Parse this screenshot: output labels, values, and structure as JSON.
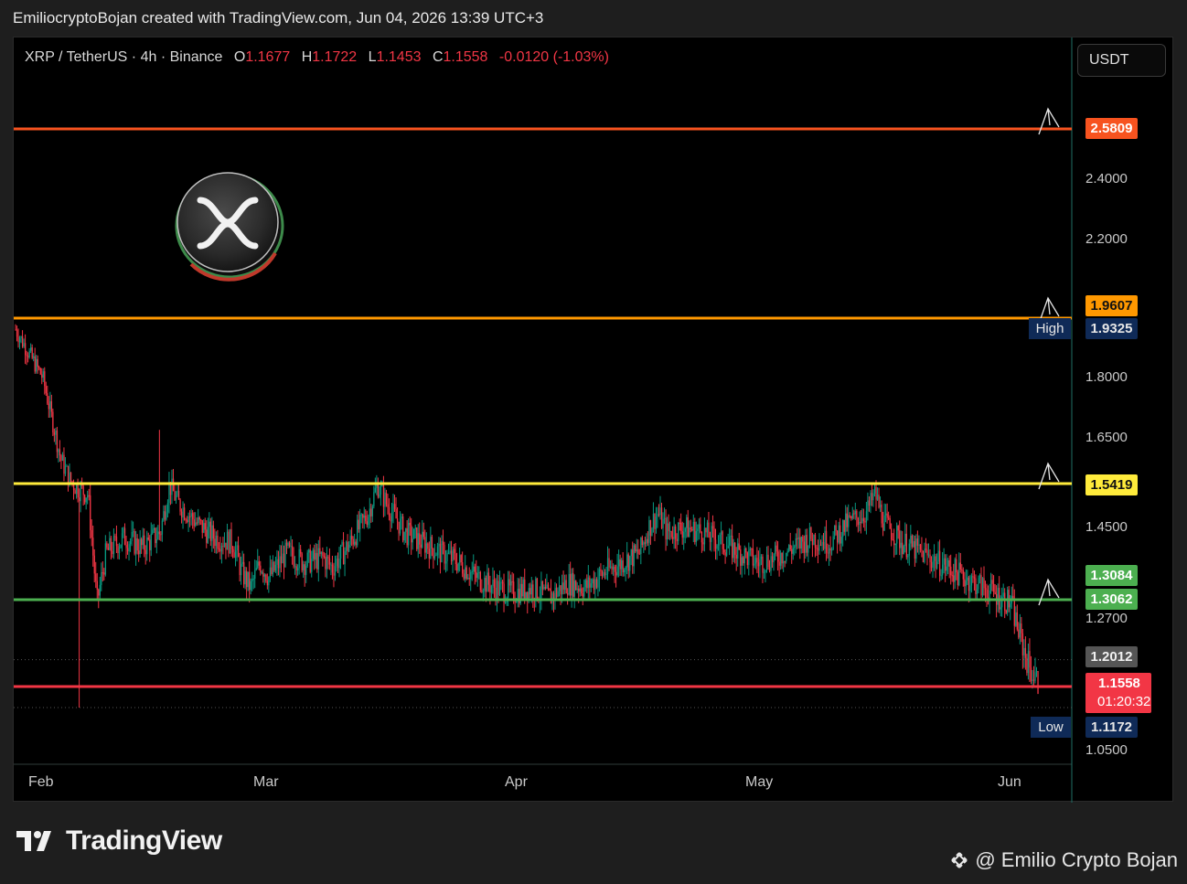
{
  "header": {
    "text": "EmiliocryptoBojan created with TradingView.com, Jun 04, 2026 13:39 UTC+3"
  },
  "legend": {
    "symbol": "XRP / TetherUS · 4h · Binance",
    "o_label": "O",
    "o": "1.1677",
    "h_label": "H",
    "h": "1.1722",
    "l_label": "L",
    "l": "1.1453",
    "c_label": "C",
    "c": "1.1558",
    "change": "-0.0120 (-1.03%)"
  },
  "currency_button": "USDT",
  "y_ticks": [
    "2.4000",
    "2.2000",
    "1.8000",
    "1.6500",
    "1.4500",
    "1.2700",
    "1.0500"
  ],
  "price_labels": {
    "r1": "2.5809",
    "r2": "1.9607",
    "high": "1.9325",
    "r3": "1.5419",
    "s1a": "1.3084",
    "s1b": "1.3062",
    "prev": "1.2012",
    "last": "1.1558",
    "countdown": "01:20:32",
    "low": "1.1172"
  },
  "tags": {
    "high": "High",
    "low": "Low"
  },
  "x_ticks": [
    "Feb",
    "Mar",
    "Apr",
    "May",
    "Jun"
  ],
  "brand": {
    "name": "TradingView",
    "credit": "@ Emilio Crypto Bojan"
  },
  "colors": {
    "up": "#089981",
    "down": "#f23645",
    "line_r1": "#f7531f",
    "line_r2": "#ff9800",
    "line_r3": "#ffeb3b",
    "line_s1": "#4caf50",
    "line_last": "#f23645"
  },
  "chart_data": {
    "type": "candlestick",
    "symbol": "XRP/USDT",
    "interval": "4h",
    "x_labels": [
      "Feb",
      "Mar",
      "Apr",
      "May",
      "Jun"
    ],
    "y_range": [
      1.0,
      2.7
    ],
    "horizontal_levels": [
      2.5809,
      1.9607,
      1.5419,
      1.3062
    ],
    "high": 1.9325,
    "low": 1.1172,
    "last": 1.1558,
    "close_path": [
      [
        0,
        1.93
      ],
      [
        3,
        1.8
      ],
      [
        5,
        1.6
      ],
      [
        6,
        1.55
      ],
      [
        7,
        1.53
      ],
      [
        8,
        1.52
      ],
      [
        9,
        1.3
      ],
      [
        10,
        1.4
      ],
      [
        12,
        1.43
      ],
      [
        14,
        1.41
      ],
      [
        16,
        1.44
      ],
      [
        17,
        1.54
      ],
      [
        18,
        1.5
      ],
      [
        20,
        1.46
      ],
      [
        22,
        1.43
      ],
      [
        24,
        1.42
      ],
      [
        25,
        1.36
      ],
      [
        26,
        1.33
      ],
      [
        27,
        1.38
      ],
      [
        28,
        1.35
      ],
      [
        30,
        1.4
      ],
      [
        32,
        1.38
      ],
      [
        34,
        1.39
      ],
      [
        35,
        1.37
      ],
      [
        37,
        1.42
      ],
      [
        39,
        1.48
      ],
      [
        40,
        1.54
      ],
      [
        41,
        1.5
      ],
      [
        43,
        1.44
      ],
      [
        45,
        1.42
      ],
      [
        47,
        1.4
      ],
      [
        49,
        1.38
      ],
      [
        51,
        1.35
      ],
      [
        53,
        1.33
      ],
      [
        55,
        1.32
      ],
      [
        57,
        1.33
      ],
      [
        59,
        1.31
      ],
      [
        61,
        1.34
      ],
      [
        63,
        1.33
      ],
      [
        65,
        1.36
      ],
      [
        67,
        1.38
      ],
      [
        69,
        1.4
      ],
      [
        70,
        1.45
      ],
      [
        71,
        1.48
      ],
      [
        72,
        1.44
      ],
      [
        74,
        1.45
      ],
      [
        76,
        1.44
      ],
      [
        78,
        1.42
      ],
      [
        80,
        1.4
      ],
      [
        82,
        1.38
      ],
      [
        84,
        1.39
      ],
      [
        86,
        1.41
      ],
      [
        88,
        1.43
      ],
      [
        90,
        1.42
      ],
      [
        92,
        1.46
      ],
      [
        94,
        1.48
      ],
      [
        95,
        1.52
      ],
      [
        96,
        1.46
      ],
      [
        98,
        1.42
      ],
      [
        100,
        1.4
      ],
      [
        102,
        1.38
      ],
      [
        104,
        1.36
      ],
      [
        106,
        1.34
      ],
      [
        108,
        1.32
      ],
      [
        110,
        1.3
      ],
      [
        111,
        1.24
      ],
      [
        112,
        1.19
      ],
      [
        113,
        1.16
      ]
    ]
  }
}
